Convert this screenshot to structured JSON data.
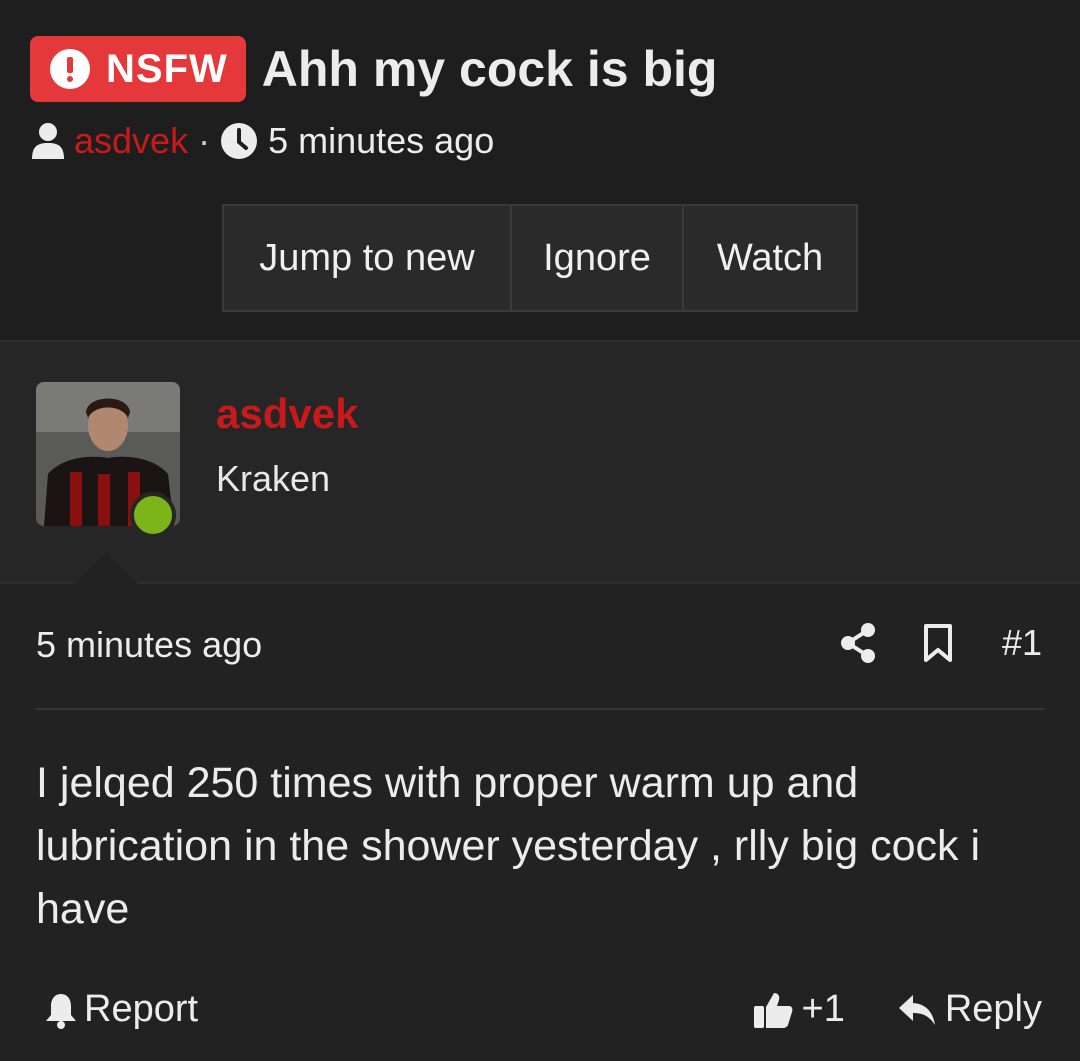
{
  "thread": {
    "prefix_label": "NSFW",
    "title": "Ahh my cock is big",
    "author": "asdvek",
    "separator": "·",
    "time": "5 minutes ago"
  },
  "buttons": {
    "jump_label": "Jump to new",
    "ignore_label": "Ignore",
    "watch_label": "Watch"
  },
  "post": {
    "username": "asdvek",
    "user_title": "Kraken",
    "time": "5 minutes ago",
    "number": "#1",
    "body": "I jelqed 250 times with proper warm up and lubrication in the shower yesterday , rlly big cock i have",
    "report_label": "Report",
    "reaction_count": "+1",
    "reply_label": "Reply"
  },
  "colors": {
    "accent_red": "#c81a1a",
    "nsfw_badge": "#e5383b",
    "online": "#7cb518",
    "background": "#222222"
  }
}
